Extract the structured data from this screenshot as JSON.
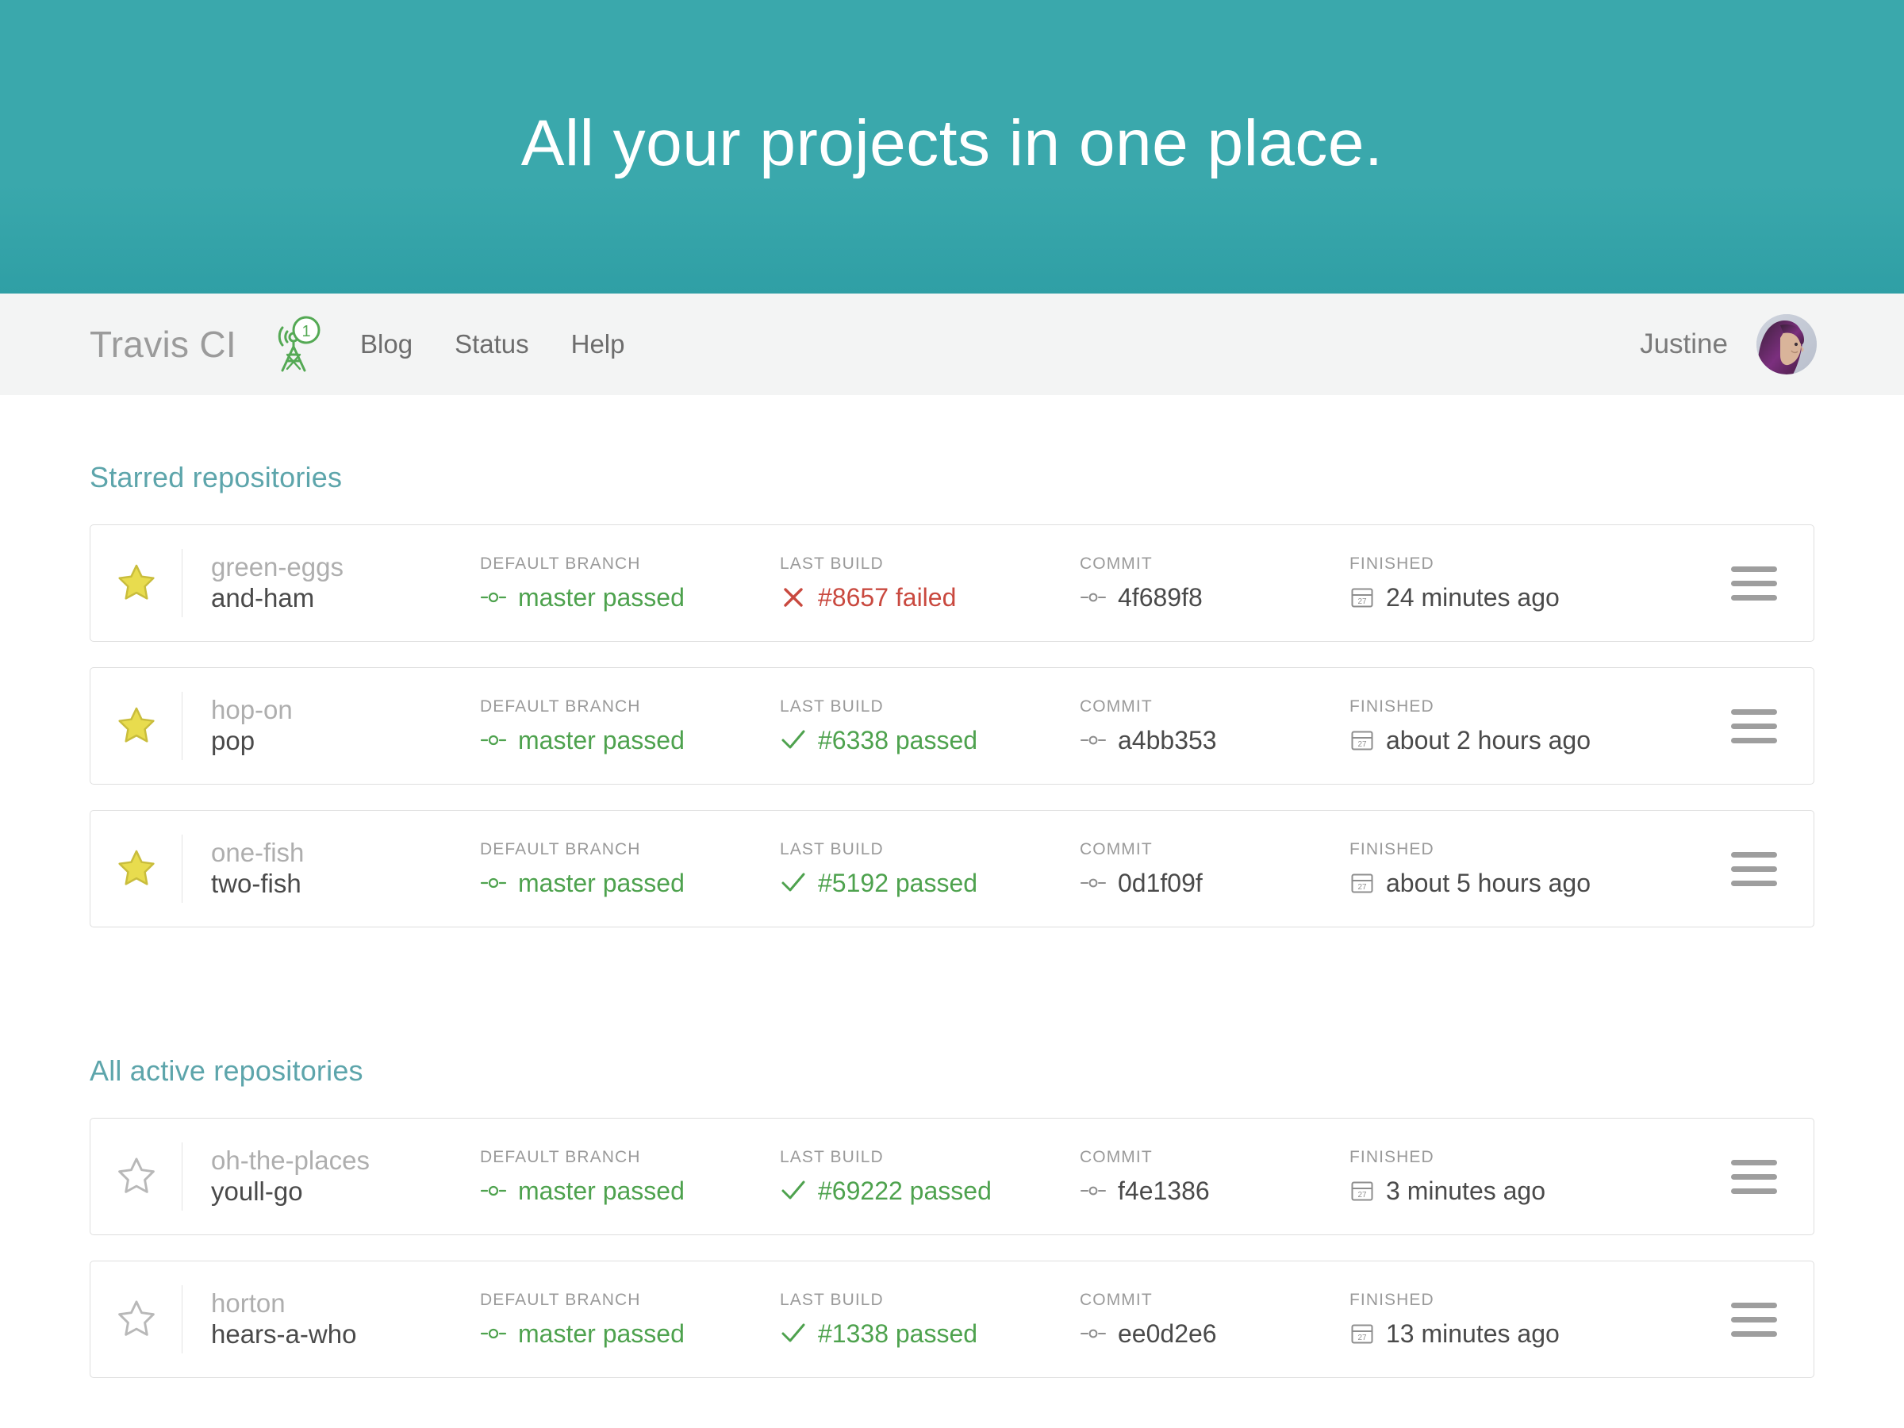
{
  "hero": {
    "title": "All your projects in one place.",
    "background_color": "#3aa8ac"
  },
  "navbar": {
    "brand": "Travis CI",
    "tower_badge_count": "1",
    "tower_icon": "broadcast-tower-icon",
    "links": [
      {
        "label": "Blog"
      },
      {
        "label": "Status"
      },
      {
        "label": "Help"
      }
    ],
    "user_name": "Justine",
    "avatar_icon": "user-avatar"
  },
  "columns": {
    "default_branch": "DEFAULT BRANCH",
    "last_build": "LAST BUILD",
    "commit": "COMMIT",
    "finished": "FINISHED"
  },
  "colors": {
    "teal": "#3aa8ac",
    "section_heading": "#5da5ab",
    "passed_green": "#4ea24e",
    "failed_red": "#c9493f",
    "star_yellow": "#e8dc4e",
    "tower_green": "#54a954"
  },
  "sections": [
    {
      "title": "Starred repositories",
      "repos": [
        {
          "starred": true,
          "owner": "green-eggs",
          "name": "and-ham",
          "branch": "master passed",
          "branch_status": "passed",
          "build": "#8657 failed",
          "build_status": "failed",
          "commit": "4f689f8",
          "finished": "24 minutes ago"
        },
        {
          "starred": true,
          "owner": "hop-on",
          "name": "pop",
          "branch": "master passed",
          "branch_status": "passed",
          "build": "#6338 passed",
          "build_status": "passed",
          "commit": "a4bb353",
          "finished": "about 2 hours ago"
        },
        {
          "starred": true,
          "owner": "one-fish",
          "name": "two-fish",
          "branch": "master passed",
          "branch_status": "passed",
          "build": "#5192 passed",
          "build_status": "passed",
          "commit": "0d1f09f",
          "finished": "about 5 hours ago"
        }
      ]
    },
    {
      "title": "All active repositories",
      "repos": [
        {
          "starred": false,
          "owner": "oh-the-places",
          "name": "youll-go",
          "branch": "master passed",
          "branch_status": "passed",
          "build": "#69222 passed",
          "build_status": "passed",
          "commit": "f4e1386",
          "finished": "3 minutes ago"
        },
        {
          "starred": false,
          "owner": "horton",
          "name": "hears-a-who",
          "branch": "master passed",
          "branch_status": "passed",
          "build": "#1338 passed",
          "build_status": "passed",
          "commit": "ee0d2e6",
          "finished": "13 minutes ago"
        }
      ]
    }
  ]
}
